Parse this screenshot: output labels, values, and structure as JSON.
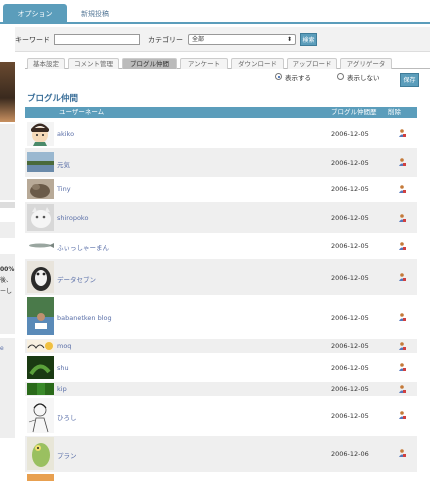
{
  "top_tabs": {
    "options": "オプション",
    "new_post": "新規投稿"
  },
  "search": {
    "keyword_label": "キーワード",
    "keyword_value": "",
    "category_label": "カテゴリー",
    "category_value": "全部",
    "button": "検索"
  },
  "left_strip": {
    "text1": "00%",
    "text2": "後、",
    "text3": "ーし",
    "text4": "e"
  },
  "sub_tabs": [
    "基本設定",
    "コメント管理",
    "ブログル仲間",
    "アンケート",
    "ダウンロード",
    "アップロード",
    "アグリゲータ"
  ],
  "visibility": {
    "show_label": "表示する",
    "hide_label": "表示しない",
    "selected": "show"
  },
  "save_button": "保存",
  "section_title": "ブログル仲間",
  "table": {
    "headers": {
      "user": "ユーザーネーム",
      "date": "ブログル仲間歴",
      "delete": "削除"
    },
    "rows": [
      {
        "name": "akiko",
        "date": "2006-12-05"
      },
      {
        "name": "元気",
        "date": "2006-12-05"
      },
      {
        "name": "Tiny",
        "date": "2006-12-05"
      },
      {
        "name": "shiropoko",
        "date": "2006-12-05"
      },
      {
        "name": "ふぃっしゃーまん",
        "date": "2006-12-05"
      },
      {
        "name": "データセブン",
        "date": "2006-12-05"
      },
      {
        "name": "babanetken blog",
        "date": "2006-12-05"
      },
      {
        "name": "moq",
        "date": "2006-12-05"
      },
      {
        "name": "shu",
        "date": "2006-12-05"
      },
      {
        "name": "kip",
        "date": "2006-12-05"
      },
      {
        "name": "ひろし",
        "date": "2006-12-05"
      },
      {
        "name": "プラン",
        "date": "2006-12-06"
      }
    ]
  },
  "colors": {
    "accent": "#5b9dbb",
    "link": "#5a6fa8",
    "title": "#3b6f99"
  }
}
